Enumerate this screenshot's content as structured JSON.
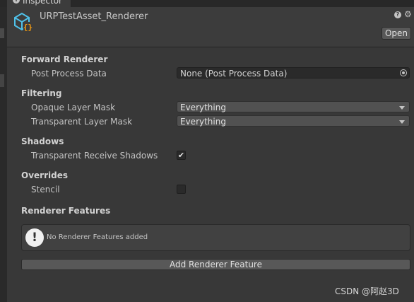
{
  "tab": {
    "label": "Inspector",
    "icon": "info-icon"
  },
  "header": {
    "title": "URPTestAsset_Renderer",
    "asset_icon": "scriptable-object-icon",
    "help_glyph": "?",
    "gear_glyph": "⚙",
    "open_label": "Open"
  },
  "forward_renderer": {
    "heading": "Forward Renderer",
    "post_process_label": "Post Process Data",
    "post_process_value": "None (Post Process Data)"
  },
  "filtering": {
    "heading": "Filtering",
    "opaque_label": "Opaque Layer Mask",
    "opaque_value": "Everything",
    "transparent_label": "Transparent Layer Mask",
    "transparent_value": "Everything"
  },
  "shadows": {
    "heading": "Shadows",
    "receive_label": "Transparent Receive Shadows",
    "receive_checked": true,
    "check_glyph": "✔"
  },
  "overrides": {
    "heading": "Overrides",
    "stencil_label": "Stencil",
    "stencil_checked": false
  },
  "renderer_features": {
    "heading": "Renderer Features",
    "info_glyph": "!",
    "empty_message": "No Renderer Features added",
    "add_label": "Add Renderer Feature"
  },
  "watermark": "CSDN @阿赵3D",
  "colors": {
    "background": "#383838",
    "field": "#2a2a2a",
    "button": "#585858",
    "icon_cyan": "#4fc1e9",
    "icon_orange": "#f39c12"
  }
}
